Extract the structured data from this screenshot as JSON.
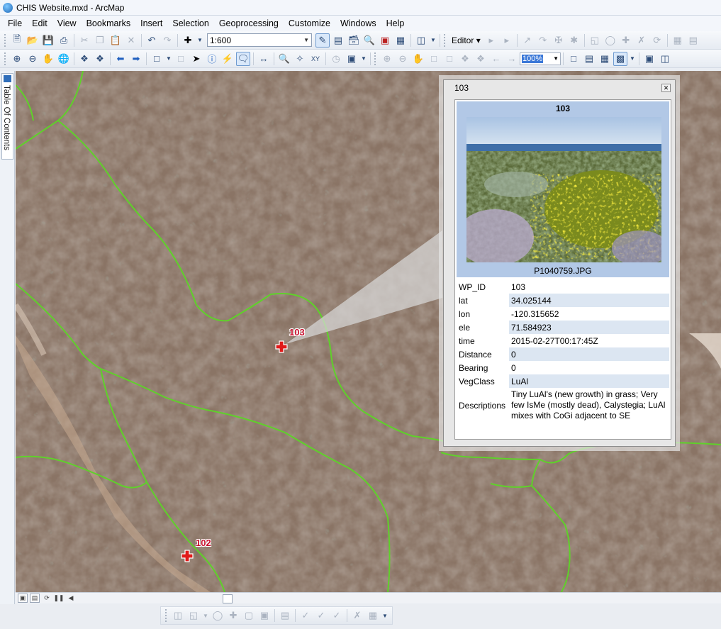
{
  "window": {
    "title": "CHIS Website.mxd - ArcMap"
  },
  "menu": [
    "File",
    "Edit",
    "View",
    "Bookmarks",
    "Insert",
    "Selection",
    "Geoprocessing",
    "Customize",
    "Windows",
    "Help"
  ],
  "toolbar": {
    "scale_value": "1:600",
    "editor_label": "Editor",
    "zoom_value": "100%"
  },
  "toc": {
    "label": "Table Of Contents"
  },
  "map": {
    "points": [
      {
        "id": "103",
        "label": "103"
      },
      {
        "id": "102",
        "label": "102"
      }
    ],
    "polygon_color": "#5fd12a",
    "marker_color": "#e01a1a"
  },
  "popup": {
    "window_title": "103",
    "header": "103",
    "photo_caption": "P1040759.JPG",
    "fields": [
      {
        "key": "WP_ID",
        "value": "103"
      },
      {
        "key": "lat",
        "value": "34.025144"
      },
      {
        "key": "lon",
        "value": "-120.315652"
      },
      {
        "key": "ele",
        "value": "71.584923"
      },
      {
        "key": "time",
        "value": "2015-02-27T00:17:45Z"
      },
      {
        "key": "Distance",
        "value": "0"
      },
      {
        "key": "Bearing",
        "value": "0"
      },
      {
        "key": "VegClass",
        "value": "LuAl"
      },
      {
        "key": "Descriptions",
        "value": "Tiny LuAl's (new growth) in grass; Very few IsMe (mostly dead), Calystegia; LuAl mixes with CoGi adjacent to SE"
      }
    ]
  }
}
